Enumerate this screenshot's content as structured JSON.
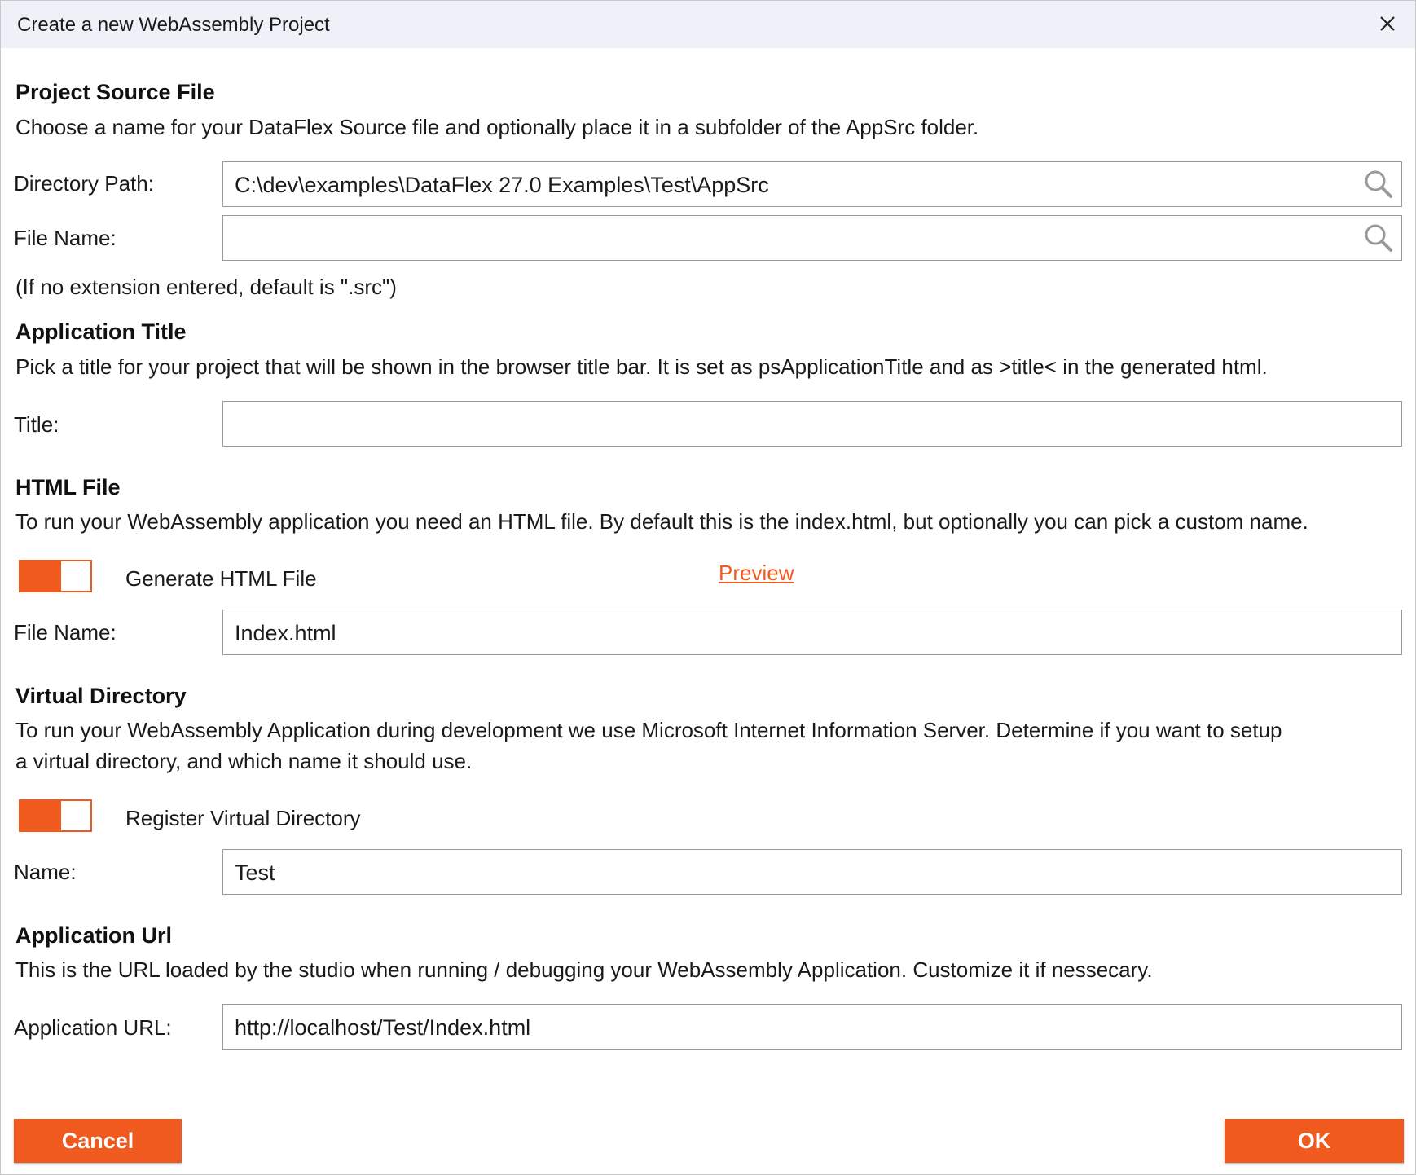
{
  "window": {
    "title": "Create a new WebAssembly Project",
    "close_icon": "close-icon"
  },
  "sections": {
    "source": {
      "heading": "Project Source File",
      "description": "Choose a name for your DataFlex Source file and optionally place it in a subfolder of the AppSrc folder.",
      "directory_label": "Directory Path:",
      "directory_value": "C:\\dev\\examples\\DataFlex 27.0 Examples\\Test\\AppSrc",
      "filename_label": "File Name:",
      "filename_value": "",
      "hint": "(If no extension entered, default is \".src\")"
    },
    "app_title": {
      "heading": "Application Title",
      "description": "Pick a title for your project that will be shown in the browser title bar. It is set as psApplicationTitle and as >title< in the generated html.",
      "title_label": "Title:",
      "title_value": ""
    },
    "html_file": {
      "heading": "HTML File",
      "description": "To run your WebAssembly application you need an HTML file. By default this is the index.html, but optionally you can pick a custom name.",
      "toggle_label": "Generate HTML File",
      "toggle_on": true,
      "preview_link": "Preview",
      "filename_label": "File Name:",
      "filename_value": "Index.html"
    },
    "virtual_dir": {
      "heading": "Virtual Directory",
      "description_line1": "To run your WebAssembly Application during development we use Microsoft Internet Information Server. Determine if you want to setup",
      "description_line2": "a virtual directory, and which name it should use.",
      "toggle_label": "Register Virtual Directory",
      "toggle_on": true,
      "name_label": "Name:",
      "name_value": "Test"
    },
    "app_url": {
      "heading": "Application Url",
      "description": "This is the URL loaded by the studio when running / debugging your WebAssembly Application. Customize it if nessecary.",
      "url_label": "Application URL:",
      "url_value": "http://localhost/Test/Index.html"
    }
  },
  "buttons": {
    "cancel": "Cancel",
    "ok": "OK"
  },
  "colors": {
    "accent": "#f05a1f",
    "titlebar": "#eef2f8",
    "field_border": "#9a9a9a"
  },
  "icons": {
    "search": "search-icon",
    "close": "close-icon"
  }
}
